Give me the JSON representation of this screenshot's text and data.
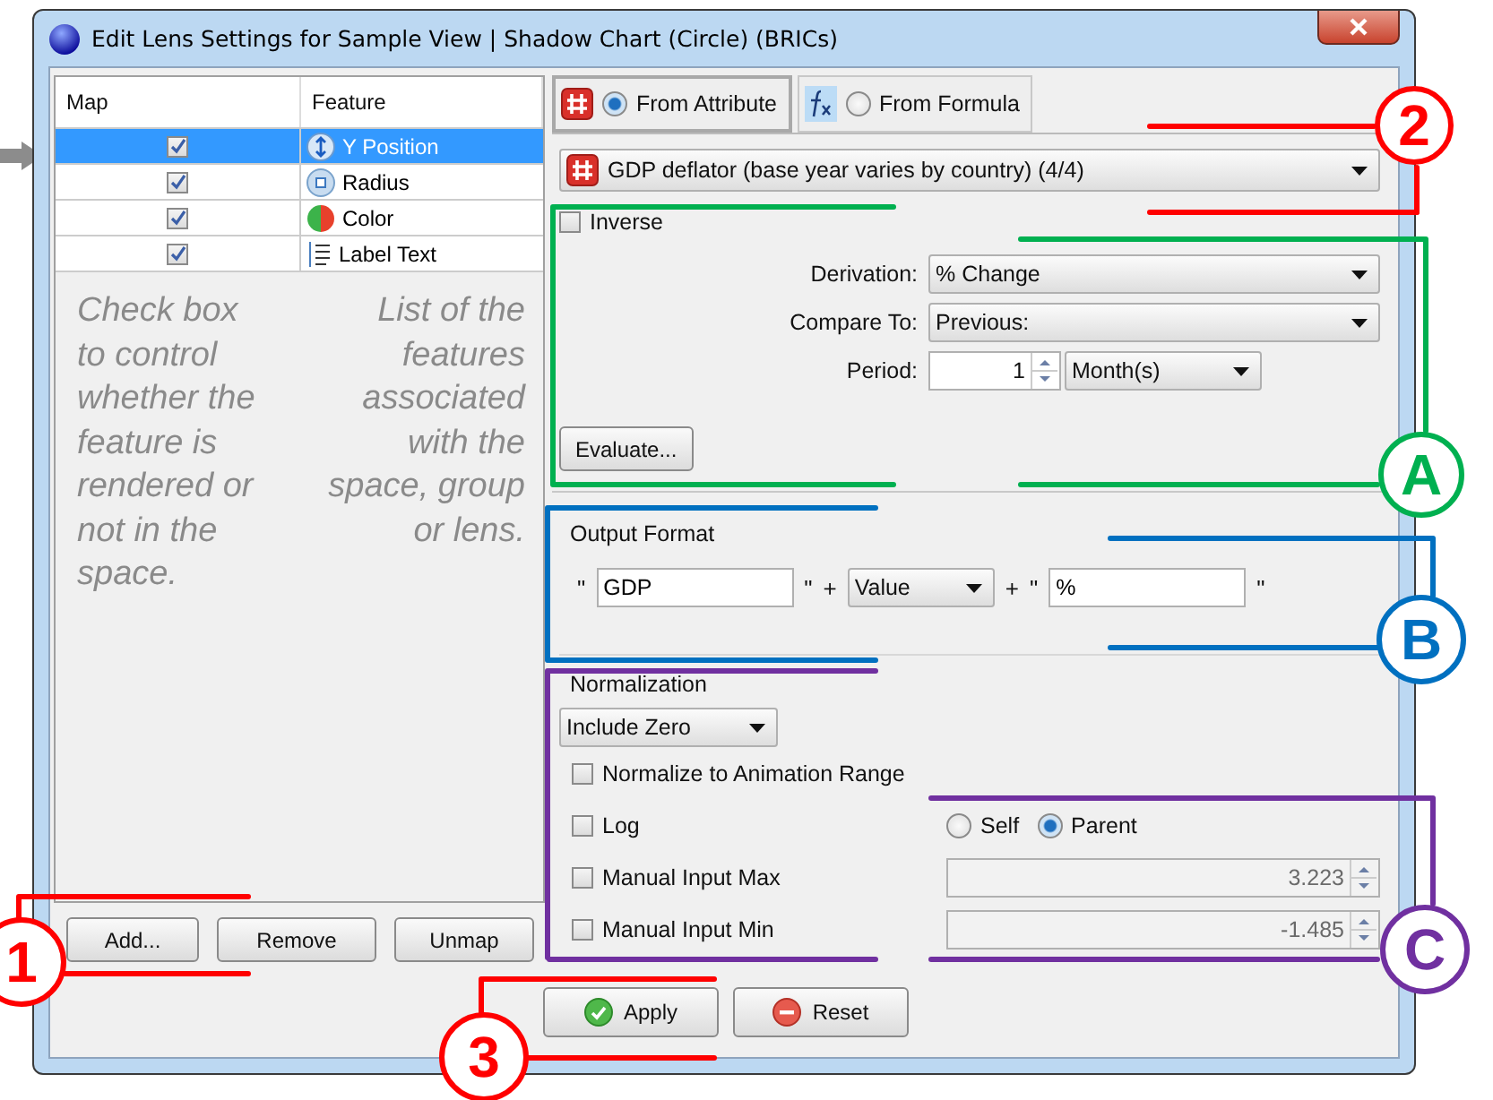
{
  "window": {
    "title": "Edit Lens Settings for Sample View | Shadow Chart (Circle) (BRICs)"
  },
  "feature_table": {
    "columns": [
      "Map",
      "Feature"
    ],
    "rows": [
      {
        "checked": true,
        "selected": true,
        "feature": "Y Position",
        "kind": "position"
      },
      {
        "checked": true,
        "selected": false,
        "feature": "Radius",
        "kind": "radius"
      },
      {
        "checked": true,
        "selected": false,
        "feature": "Color",
        "kind": "color"
      },
      {
        "checked": true,
        "selected": false,
        "feature": "Label Text",
        "kind": "text"
      }
    ]
  },
  "notes": [
    "Check box to control whether the feature is rendered or not in the space.",
    "List of the features associated with the space, group or lens."
  ],
  "left_buttons": [
    "Add...",
    "Remove",
    "Unmap"
  ],
  "source_tabs": [
    {
      "label": "From Attribute",
      "selected": true,
      "kind": "attribute"
    },
    {
      "label": "From Formula",
      "selected": false,
      "kind": "formula"
    }
  ],
  "attribute": "GDP deflator (base year varies by country) (4/4)",
  "inverse": {
    "label": "Inverse",
    "checked": false
  },
  "derivation": {
    "label": "Derivation:",
    "value": "% Change"
  },
  "compare_to": {
    "label": "Compare To:",
    "value": "Previous:"
  },
  "period": {
    "label": "Period:",
    "value": "1",
    "unit": "Month(s)"
  },
  "evaluate_button": "Evaluate...",
  "output_format": {
    "title": "Output Format",
    "items": [
      {
        "kind": "quote",
        "text": "\""
      },
      {
        "kind": "field",
        "text": "GDP"
      },
      {
        "kind": "quote",
        "text": "\""
      },
      {
        "kind": "plus",
        "text": "+"
      },
      {
        "kind": "select",
        "text": "Value"
      },
      {
        "kind": "plus",
        "text": "+"
      },
      {
        "kind": "quote",
        "text": "\""
      },
      {
        "kind": "field",
        "text": "%"
      },
      {
        "kind": "quote",
        "text": "\""
      }
    ]
  },
  "normalization": {
    "title": "Normalization",
    "mode": "Include Zero",
    "animation_range": {
      "label": "Normalize to Animation Range",
      "checked": false
    },
    "log": {
      "label": "Log",
      "checked": false
    },
    "scope": [
      {
        "label": "Self",
        "selected": false
      },
      {
        "label": "Parent",
        "selected": true
      }
    ],
    "max": {
      "label": "Manual Input Max",
      "checked": false,
      "value": "3.223",
      "disabled": true
    },
    "min": {
      "label": "Manual Input Min",
      "checked": false,
      "value": "-1.485",
      "disabled": true
    }
  },
  "actions": [
    {
      "label": "Apply",
      "kind": "apply"
    },
    {
      "label": "Reset",
      "kind": "reset"
    }
  ],
  "callouts": [
    {
      "label": "2",
      "color": "#ff0000"
    },
    {
      "label": "A",
      "color": "#00b050"
    },
    {
      "label": "B",
      "color": "#0070c0"
    },
    {
      "label": "C",
      "color": "#7030a0"
    },
    {
      "label": "1",
      "color": "#ff0000"
    },
    {
      "label": "3",
      "color": "#ff0000"
    }
  ]
}
